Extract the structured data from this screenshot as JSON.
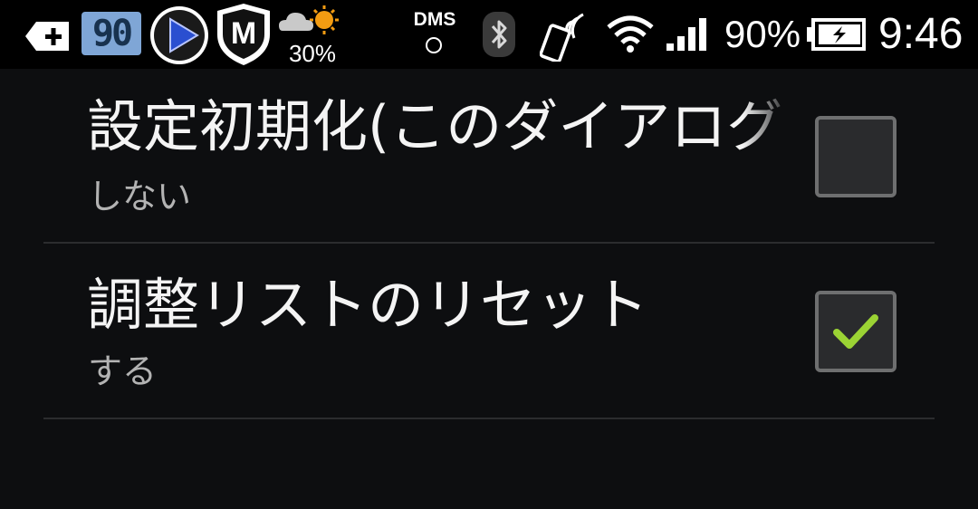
{
  "status_bar": {
    "notification_number": "90",
    "weather_percent": "30%",
    "dms_label": "DMS",
    "battery_percent": "90%",
    "clock": "9:46",
    "icons": [
      "add-tab-icon",
      "number-badge-icon",
      "play-icon",
      "shield-m-icon",
      "weather-icon",
      "dms-icon",
      "bluetooth-icon",
      "nfc-phone-icon",
      "wifi-icon",
      "signal-icon",
      "battery-charging-icon"
    ]
  },
  "preferences": [
    {
      "title": "設定初期化(このダイアログ",
      "summary": "しない",
      "checked": false
    },
    {
      "title": "調整リストのリセット",
      "summary": "する",
      "checked": true
    }
  ],
  "colors": {
    "background": "#0d0e10",
    "check_mark": "#9bd334",
    "badge": "#7fa6d6"
  }
}
